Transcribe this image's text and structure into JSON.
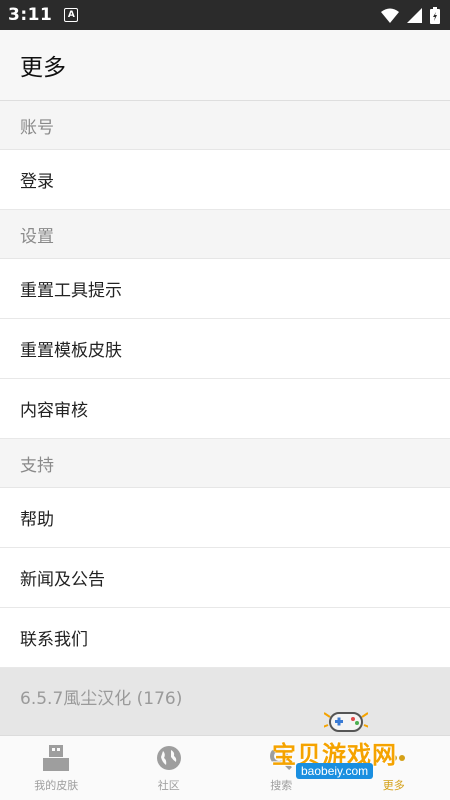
{
  "status_bar": {
    "time": "3:11",
    "notification_letter": "A"
  },
  "app_bar": {
    "title": "更多"
  },
  "sections": {
    "account": {
      "header": "账号",
      "items": [
        "登录"
      ]
    },
    "settings": {
      "header": "设置",
      "items": [
        "重置工具提示",
        "重置模板皮肤",
        "内容审核"
      ]
    },
    "support": {
      "header": "支持",
      "items": [
        "帮助",
        "新闻及公告",
        "联系我们"
      ]
    }
  },
  "version_text": "6.5.7風尘汉化 (176)",
  "bottom_nav": {
    "tabs": [
      {
        "label": "我的皮肤",
        "icon": "skin-icon",
        "active": false
      },
      {
        "label": "社区",
        "icon": "globe-icon",
        "active": false
      },
      {
        "label": "搜索",
        "icon": "search-icon",
        "active": false
      },
      {
        "label": "更多",
        "icon": "more-icon",
        "active": true
      }
    ],
    "active_color": "#d4a017"
  },
  "watermark": {
    "text": "宝贝游戏网",
    "url": "baobeiy.com"
  }
}
